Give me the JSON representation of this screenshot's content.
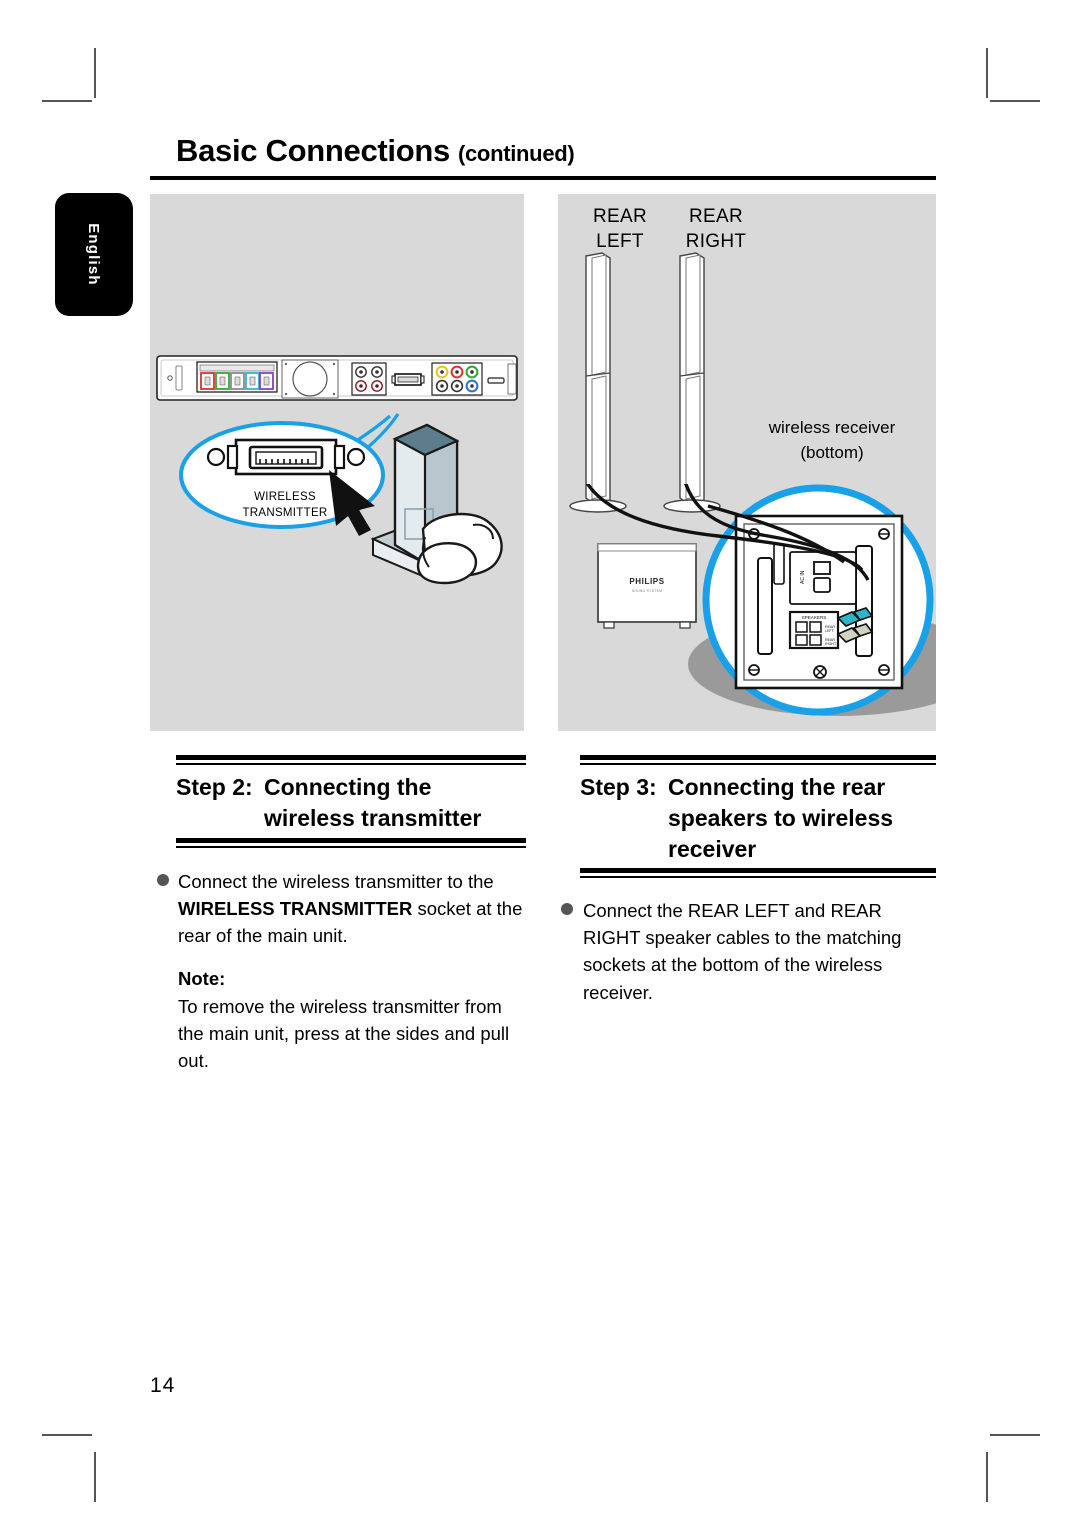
{
  "document": {
    "title_main": "Basic Connections",
    "title_suffix": "(continued)",
    "page_number": "14",
    "language_tab": "English"
  },
  "left_panel": {
    "callout_label_line1": "WIRELESS",
    "callout_label_line2": "TRANSMITTER",
    "rear_panel_alt": "main unit rear panel",
    "hand_alt": "hand holding wireless transmitter"
  },
  "right_panel": {
    "rear_left_line1": "REAR",
    "rear_left_line2": "LEFT",
    "rear_right_line1": "REAR",
    "rear_right_line2": "RIGHT",
    "receiver_label_line1": "wireless receiver",
    "receiver_label_line2": "(bottom)",
    "subwoofer_brand": "PHILIPS",
    "speaker_terminal_label": "SPEAKERS"
  },
  "step2": {
    "label": "Step 2:",
    "title_line1": "Connecting the",
    "title_line2": "wireless transmitter",
    "body_pre": "Connect the wireless transmitter to the ",
    "body_bold": "WIRELESS TRANSMITTER",
    "body_post": " socket at the rear of the main unit.",
    "note_heading": "Note:",
    "note_body": "To remove the wireless transmitter from the main unit, press at the sides and pull out."
  },
  "step3": {
    "label": "Step 3:",
    "title_line1": "Connecting the rear",
    "title_line2": "speakers to wireless",
    "title_line3": "receiver",
    "body": "Connect the REAR LEFT and REAR RIGHT speaker cables to the matching sockets at the bottom of the wireless receiver."
  },
  "colors": {
    "panel_gray": "#d9d9d9",
    "callout_blue": "#18a0e8",
    "terminal_red": "#e03030",
    "terminal_green": "#2faa2f",
    "terminal_cyan": "#2fb5c8",
    "terminal_purple": "#8a3fc0",
    "terminal_yellow": "#e8c41e"
  }
}
